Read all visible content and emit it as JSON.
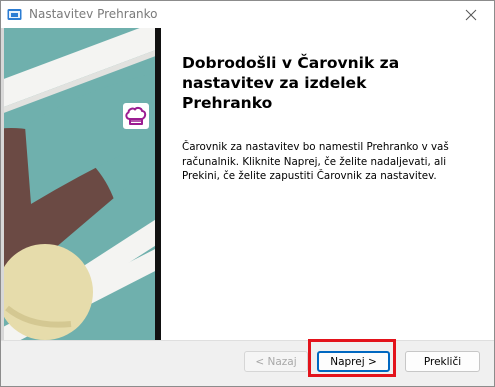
{
  "window": {
    "title": "Nastavitev Prehranko",
    "app_icon": "installer-icon",
    "close_icon": "close-icon"
  },
  "welcome": {
    "heading": "Dobrodošli v Čarovnik za nastavitev za izdelek Prehranko",
    "description": "Čarovnik za nastavitev bo namestil Prehranko v vaš računalnik. Kliknite Naprej, če želite nadaljevati, ali Prekini, če želite zapustiti Čarovnik za nastavitev."
  },
  "banner": {
    "icon": "chef-hat-icon",
    "colors": {
      "teal": "#6fb0ad",
      "brown": "#6b4a44",
      "cream": "#e6dcab",
      "white_stripe": "#f4f4f2",
      "accent": "#9b1d92"
    }
  },
  "buttons": {
    "back_label": "< Nazaj",
    "next_label": "Naprej >",
    "cancel_label": "Prekliči"
  },
  "highlight_color": "#e3131b"
}
